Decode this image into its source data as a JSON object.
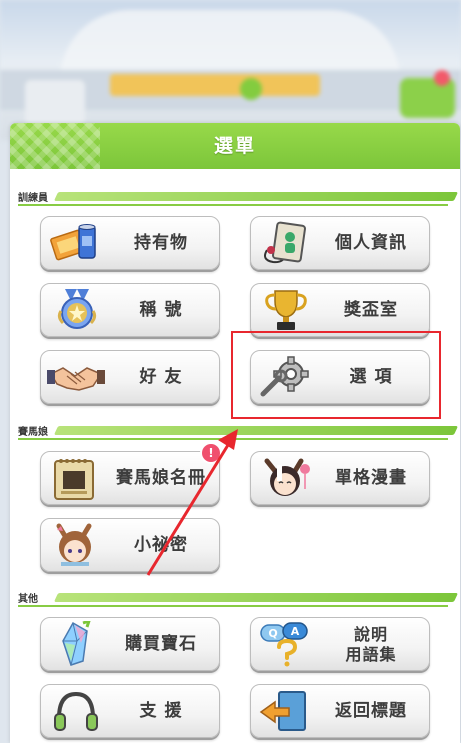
{
  "header": {
    "title": "選單"
  },
  "sections": {
    "trainer": "訓練員",
    "umamusume": "賽馬娘",
    "other": "其他"
  },
  "buttons": {
    "items": "持有物",
    "profile": "個人資訊",
    "titles": "稱 號",
    "trophy": "獎盃室",
    "friends": "好 友",
    "options": "選 項",
    "roster": "賽馬娘名冊",
    "comic": "單格漫畫",
    "secrets": "小祕密",
    "buy_gems": "購買寶石",
    "help_line1": "說明",
    "help_line2": "用語集",
    "support": "支 援",
    "return_title": "返回標題"
  },
  "badges": {
    "roster": "!"
  },
  "colors": {
    "accent_green": "#7cc63a",
    "highlight_red": "#e8272e",
    "badge_pink": "#f0506e"
  },
  "icons": {
    "items": "ticket-can-icon",
    "profile": "id-card-icon",
    "titles": "medal-icon",
    "trophy": "trophy-icon",
    "friends": "handshake-icon",
    "options": "gear-wrench-icon",
    "roster": "notebook-icon",
    "comic": "character-portrait-icon",
    "secrets": "character-portrait-icon",
    "buy_gems": "gem-icon",
    "help": "qa-bubble-icon",
    "support": "headset-icon",
    "return_title": "door-arrow-icon"
  }
}
